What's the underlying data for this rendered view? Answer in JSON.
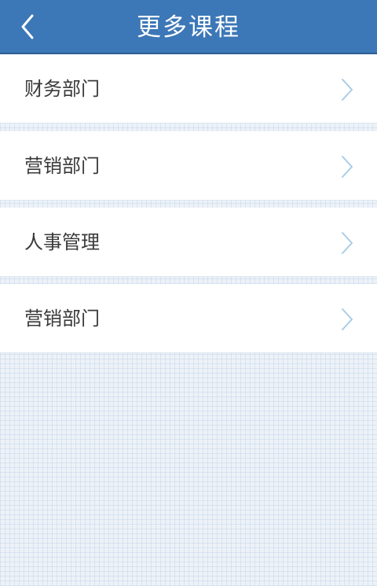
{
  "header": {
    "title": "更多课程",
    "back_icon": "chevron-left-icon",
    "background_color": "#3c77b7"
  },
  "items": [
    {
      "label": "财务部门",
      "icon": "chevron-right-icon"
    },
    {
      "label": "营销部门",
      "icon": "chevron-right-icon"
    },
    {
      "label": "人事管理",
      "icon": "chevron-right-icon"
    },
    {
      "label": "营销部门",
      "icon": "chevron-right-icon"
    }
  ]
}
